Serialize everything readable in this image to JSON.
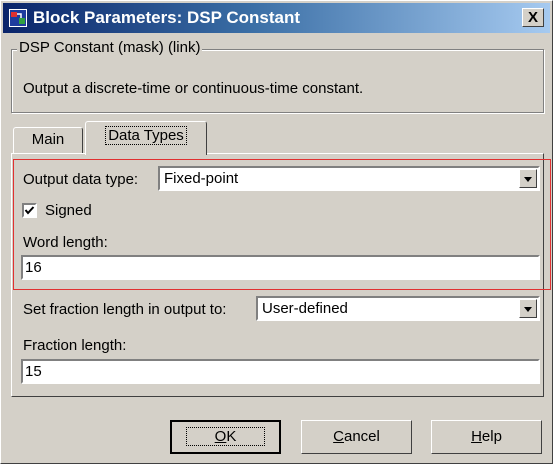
{
  "window": {
    "title": "Block Parameters: DSP Constant",
    "close_label": "X"
  },
  "mask_group": {
    "legend": "DSP Constant (mask) (link)",
    "description": "Output a discrete-time or continuous-time constant."
  },
  "tabs": [
    {
      "label": "Main",
      "active": false
    },
    {
      "label": "Data Types",
      "active": true
    }
  ],
  "data_types": {
    "output_data_type_label": "Output data type:",
    "output_data_type_value": "Fixed-point",
    "signed_label": "Signed",
    "signed_checked": true,
    "word_length_label": "Word length:",
    "word_length_value": "16",
    "fraction_mode_label": "Set fraction length in output to:",
    "fraction_mode_value": "User-defined",
    "fraction_length_label": "Fraction length:",
    "fraction_length_value": "15"
  },
  "buttons": {
    "ok_mnemonic": "O",
    "ok_rest": "K",
    "cancel_mnemonic": "C",
    "cancel_rest": "ancel",
    "help_mnemonic": "H",
    "help_rest": "elp"
  },
  "colors": {
    "title_gradient_start": "#0a246a",
    "title_gradient_end": "#a6caf0",
    "highlight_border": "#e03030",
    "dialog_face": "#d4d0c8"
  }
}
